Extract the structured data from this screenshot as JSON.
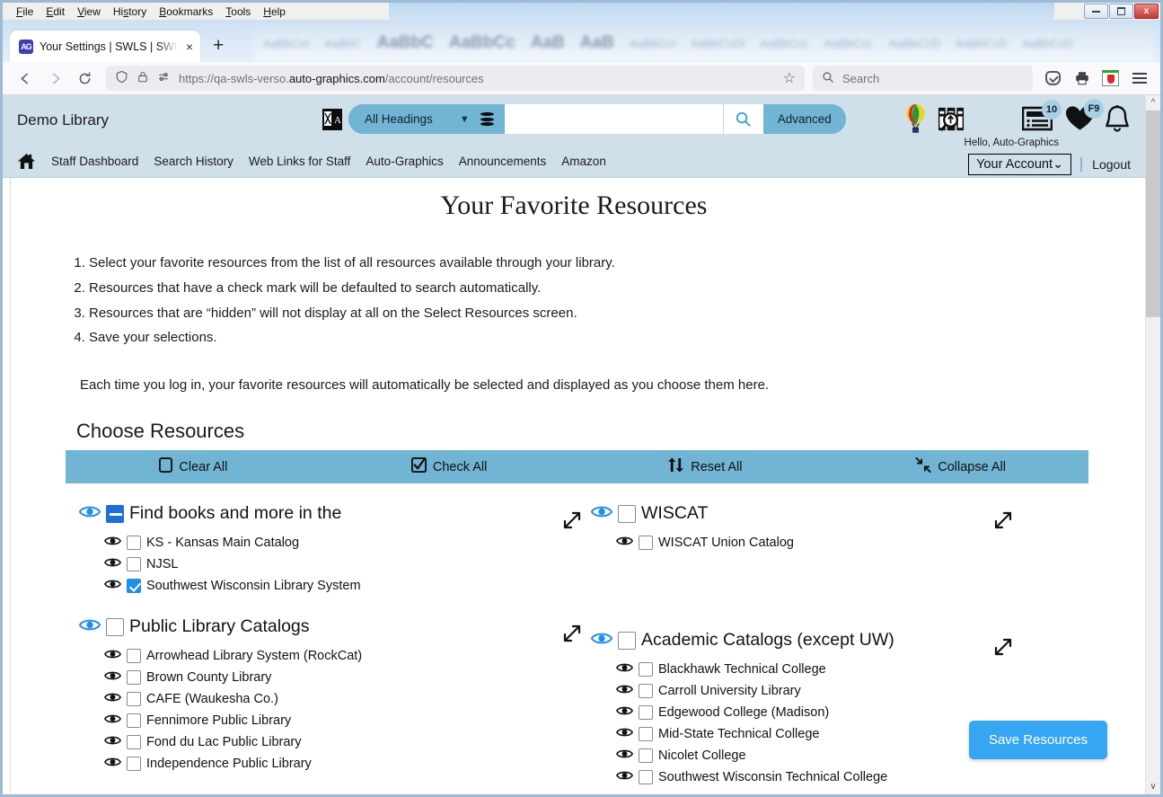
{
  "browser": {
    "menus": [
      "File",
      "Edit",
      "View",
      "History",
      "Bookmarks",
      "Tools",
      "Help"
    ],
    "window_controls": {
      "minimize": "minimize",
      "restore": "restore",
      "close": "close"
    },
    "tab": {
      "title": "Your Settings | SWLS | SWLS | Au",
      "favicon_label": "AG",
      "close_label": "×",
      "new_tab_label": "+"
    },
    "nav": {
      "back": "←",
      "forward": "→",
      "reload": "↻"
    },
    "url": {
      "prefix": "https://qa-swls-verso.",
      "host": "auto-graphics.com",
      "path": "/account/resources",
      "bookmark_label": "☆"
    },
    "search": {
      "placeholder": "Search"
    },
    "toolbar_icons": [
      "shield-icon",
      "lock-icon",
      "permissions-icon",
      "pocket-icon",
      "print-icon",
      "extension-icon",
      "menu-icon"
    ]
  },
  "app": {
    "library_name": "Demo Library",
    "search": {
      "scope": "All Headings",
      "value": "",
      "advanced_label": "Advanced",
      "translate_icon": "translate-icon",
      "database_icon": "database-icon",
      "go_icon": "search-icon"
    },
    "header_icons": [
      {
        "name": "balloon-icon",
        "badge": ""
      },
      {
        "name": "research-icon",
        "badge": ""
      },
      {
        "name": "news-list-icon",
        "badge": "10"
      },
      {
        "name": "favorites-heart-icon",
        "badge": "F9"
      },
      {
        "name": "notification-bell-icon",
        "badge": ""
      }
    ],
    "nav_links": [
      "Staff Dashboard",
      "Search History",
      "Web Links for Staff",
      "Auto-Graphics",
      "Announcements",
      "Amazon"
    ],
    "home_icon": "home-icon",
    "account": {
      "greeting": "Hello, Auto-Graphics",
      "dropdown_label": "Your Account",
      "dropdown_caret": "⌄",
      "logout_label": "Logout"
    }
  },
  "page": {
    "title": "Your Favorite Resources",
    "steps": [
      "Select your favorite resources from the list of all resources available through your library.",
      "Resources that have a check mark will be defaulted to search automatically.",
      "Resources that are “hidden” will not display at all on the Select Resources screen.",
      "Save your selections."
    ],
    "note": "Each time you log in, your favorite resources will automatically be selected and displayed as you choose them here.",
    "section_heading": "Choose Resources",
    "actions": [
      {
        "label": "Clear All",
        "icon": "empty-checkbox-icon"
      },
      {
        "label": "Check All",
        "icon": "checked-checkbox-icon"
      },
      {
        "label": "Reset All",
        "icon": "reset-arrows-icon"
      },
      {
        "label": "Collapse All",
        "icon": "collapse-arrows-icon"
      }
    ],
    "save_label": "Save Resources",
    "expand_icon": "expand-diagonal-icon",
    "eye_icon": "eye-visible-icon",
    "columns": [
      {
        "groups": [
          {
            "name": "Find books and more in the",
            "state": "indeterminate",
            "items": [
              {
                "name": "KS - Kansas Main Catalog",
                "checked": false
              },
              {
                "name": "NJSL",
                "checked": false
              },
              {
                "name": "Southwest Wisconsin Library System",
                "checked": true
              }
            ]
          },
          {
            "name": "Public Library Catalogs",
            "state": "unchecked",
            "items": [
              {
                "name": "Arrowhead Library System (RockCat)",
                "checked": false
              },
              {
                "name": "Brown County Library",
                "checked": false
              },
              {
                "name": "CAFE (Waukesha Co.)",
                "checked": false
              },
              {
                "name": "Fennimore Public Library",
                "checked": false
              },
              {
                "name": "Fond du Lac Public Library",
                "checked": false
              },
              {
                "name": "Independence Public Library",
                "checked": false
              }
            ]
          }
        ]
      },
      {
        "groups": [
          {
            "name": "WISCAT",
            "state": "unchecked",
            "items": [
              {
                "name": "WISCAT Union Catalog",
                "checked": false
              }
            ]
          },
          {
            "name": "Academic Catalogs (except UW)",
            "state": "unchecked",
            "items": [
              {
                "name": "Blackhawk Technical College",
                "checked": false
              },
              {
                "name": "Carroll University Library",
                "checked": false
              },
              {
                "name": "Edgewood College (Madison)",
                "checked": false
              },
              {
                "name": "Mid-State Technical College",
                "checked": false
              },
              {
                "name": "Nicolet College",
                "checked": false
              },
              {
                "name": "Southwest Wisconsin Technical College",
                "checked": false
              }
            ]
          }
        ]
      }
    ]
  },
  "colors": {
    "header_bg": "#cfe0eb",
    "accent_blue": "#72b4d4",
    "save_button": "#36a6f2",
    "checked_blue": "#1f8fe8"
  }
}
